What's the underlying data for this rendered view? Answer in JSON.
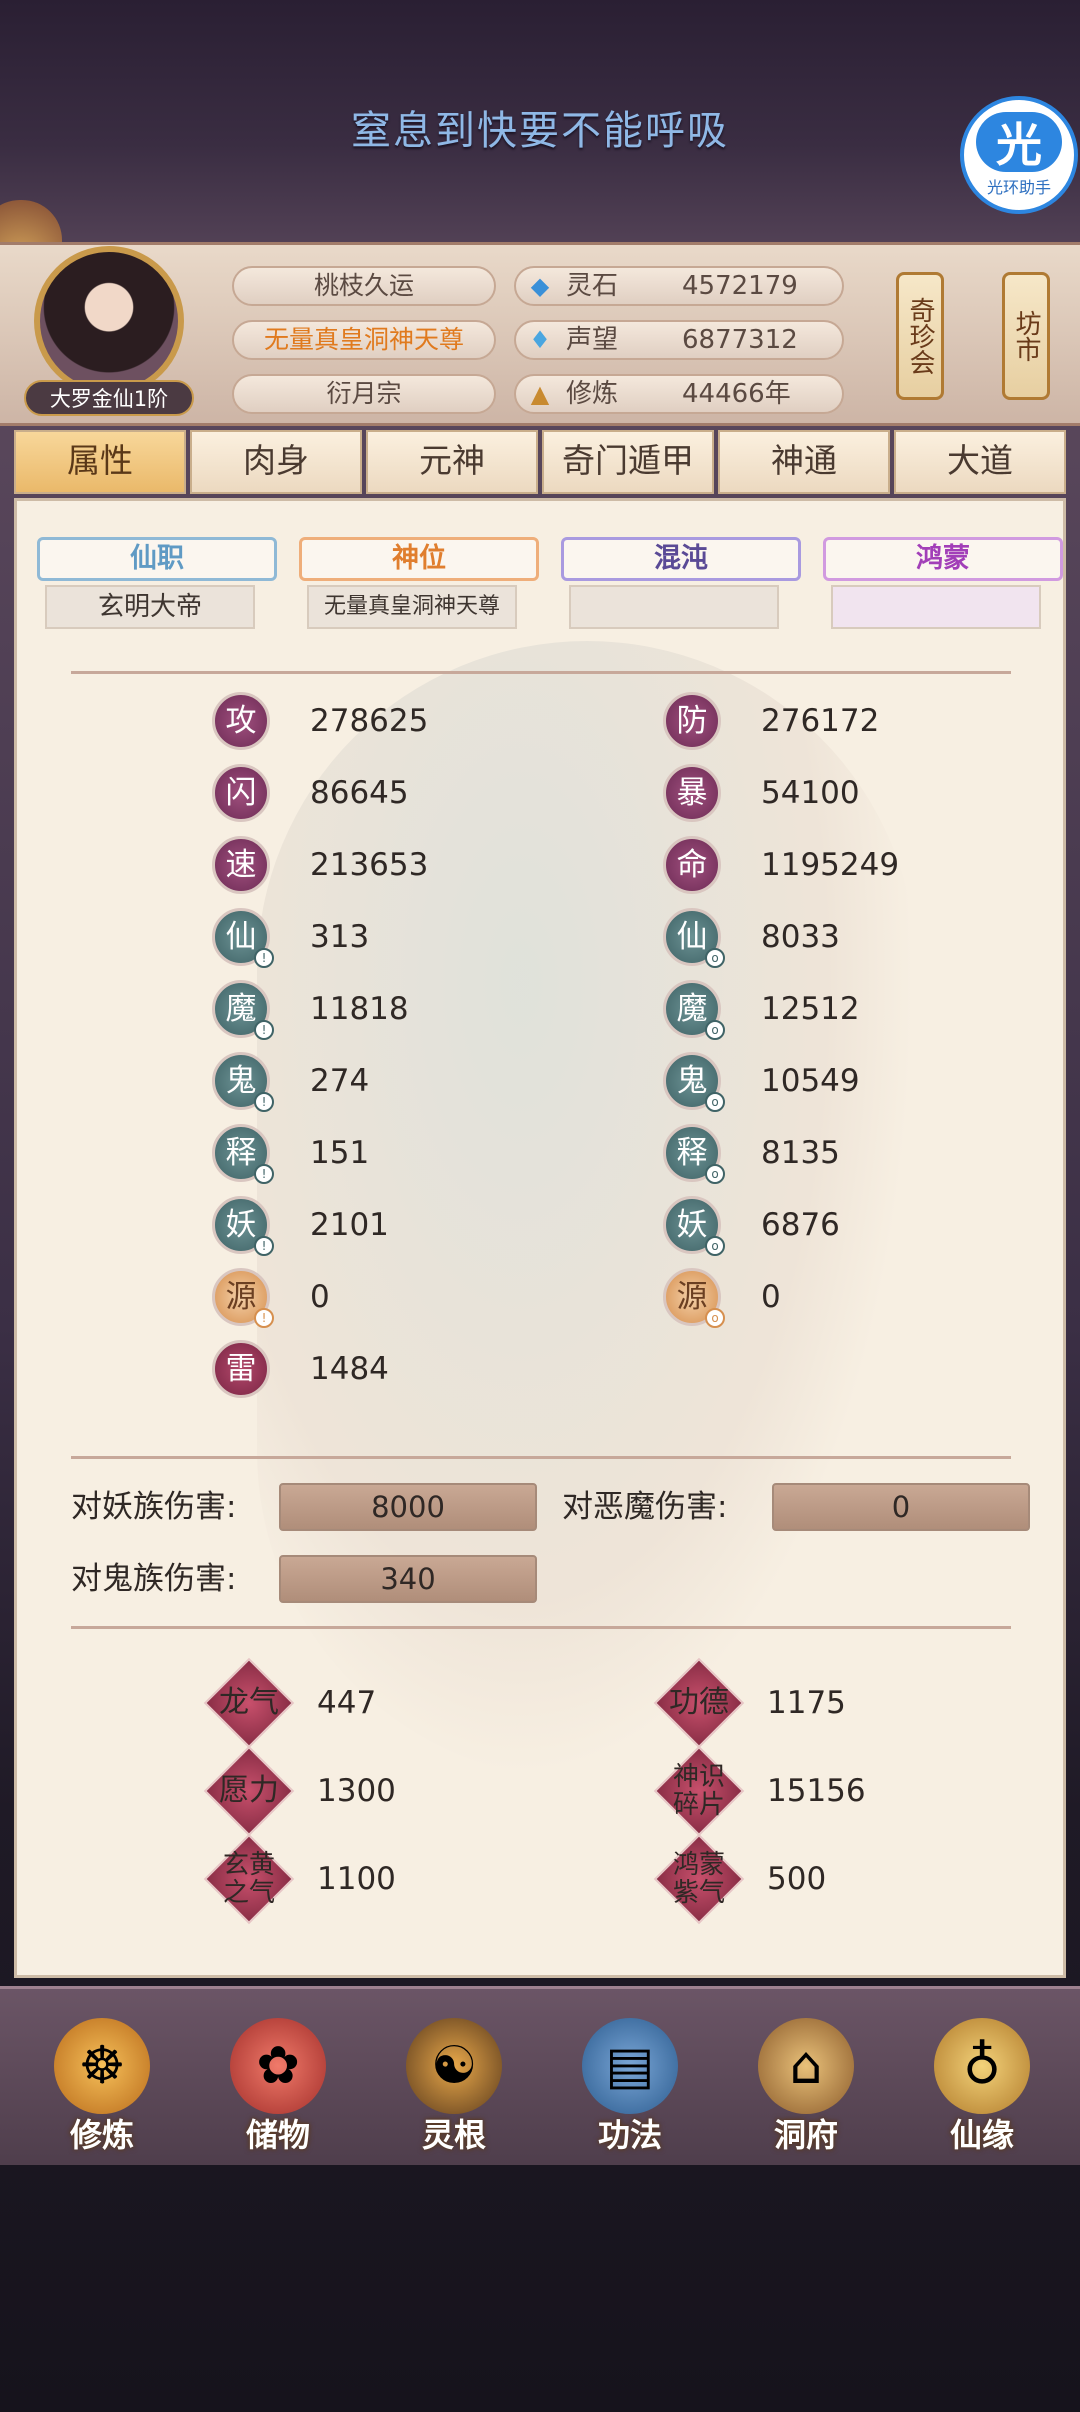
{
  "title": "窒息到快要不能呼吸",
  "helper": {
    "glyph": "光",
    "label": "光环助手"
  },
  "profile": {
    "rank": "大罗金仙1阶",
    "name": "桃枝久运",
    "title": "无量真皇洞神天尊",
    "sect": "衍月宗",
    "resources": [
      {
        "icon": "spirit-stone-icon",
        "label": "灵石",
        "value": "4572179"
      },
      {
        "icon": "reputation-icon",
        "label": "声望",
        "value": "6877312"
      },
      {
        "icon": "cultivation-icon",
        "label": "修炼",
        "value": "44466年"
      }
    ],
    "shops": [
      "奇珍会",
      "坊市"
    ]
  },
  "tabs": [
    "属性",
    "肉身",
    "元神",
    "奇门遁甲",
    "神通",
    "大道"
  ],
  "subtabs": [
    {
      "label": "仙职",
      "value": "玄明大帝",
      "color": "#6aa0c8"
    },
    {
      "label": "神位",
      "value": "无量真皇洞神天尊",
      "color": "#e58a36"
    },
    {
      "label": "混沌",
      "value": "",
      "color": "#7c6ad0"
    },
    {
      "label": "鸿蒙",
      "value": "",
      "color": "#b55ac8"
    }
  ],
  "stats_left": [
    {
      "glyph": "攻",
      "value": "278625",
      "kind": "purple"
    },
    {
      "glyph": "闪",
      "value": "86645",
      "kind": "purple"
    },
    {
      "glyph": "速",
      "value": "213653",
      "kind": "purple"
    },
    {
      "glyph": "仙",
      "value": "313",
      "kind": "teal"
    },
    {
      "glyph": "魔",
      "value": "11818",
      "kind": "teal"
    },
    {
      "glyph": "鬼",
      "value": "274",
      "kind": "teal"
    },
    {
      "glyph": "释",
      "value": "151",
      "kind": "teal"
    },
    {
      "glyph": "妖",
      "value": "2101",
      "kind": "teal"
    },
    {
      "glyph": "源",
      "value": "0",
      "kind": "gold"
    },
    {
      "glyph": "雷",
      "value": "1484",
      "kind": "red"
    }
  ],
  "stats_right": [
    {
      "glyph": "防",
      "value": "276172",
      "kind": "purple"
    },
    {
      "glyph": "暴",
      "value": "54100",
      "kind": "purple"
    },
    {
      "glyph": "命",
      "value": "1195249",
      "kind": "purple"
    },
    {
      "glyph": "仙",
      "value": "8033",
      "kind": "teal"
    },
    {
      "glyph": "魔",
      "value": "12512",
      "kind": "teal"
    },
    {
      "glyph": "鬼",
      "value": "10549",
      "kind": "teal"
    },
    {
      "glyph": "释",
      "value": "8135",
      "kind": "teal"
    },
    {
      "glyph": "妖",
      "value": "6876",
      "kind": "teal"
    },
    {
      "glyph": "源",
      "value": "0",
      "kind": "gold"
    }
  ],
  "damage": [
    {
      "label": "对妖族伤害:",
      "value": "8000"
    },
    {
      "label": "对恶魔伤害:",
      "value": "0"
    },
    {
      "label": "对鬼族伤害:",
      "value": "340"
    }
  ],
  "extras": [
    {
      "label": "龙气",
      "value": "447"
    },
    {
      "label": "功德",
      "value": "1175"
    },
    {
      "label": "愿力",
      "value": "1300"
    },
    {
      "label": "神识碎片",
      "value": "15156"
    },
    {
      "label": "玄黄之气",
      "value": "1100"
    },
    {
      "label": "鸿蒙紫气",
      "value": "500"
    }
  ],
  "nav": [
    {
      "label": "修炼",
      "icon": "monk-icon"
    },
    {
      "label": "储物",
      "icon": "bag-icon"
    },
    {
      "label": "灵根",
      "icon": "spirit-root-icon"
    },
    {
      "label": "功法",
      "icon": "book-icon"
    },
    {
      "label": "洞府",
      "icon": "mansion-icon"
    },
    {
      "label": "仙缘",
      "icon": "gourd-icon"
    }
  ]
}
